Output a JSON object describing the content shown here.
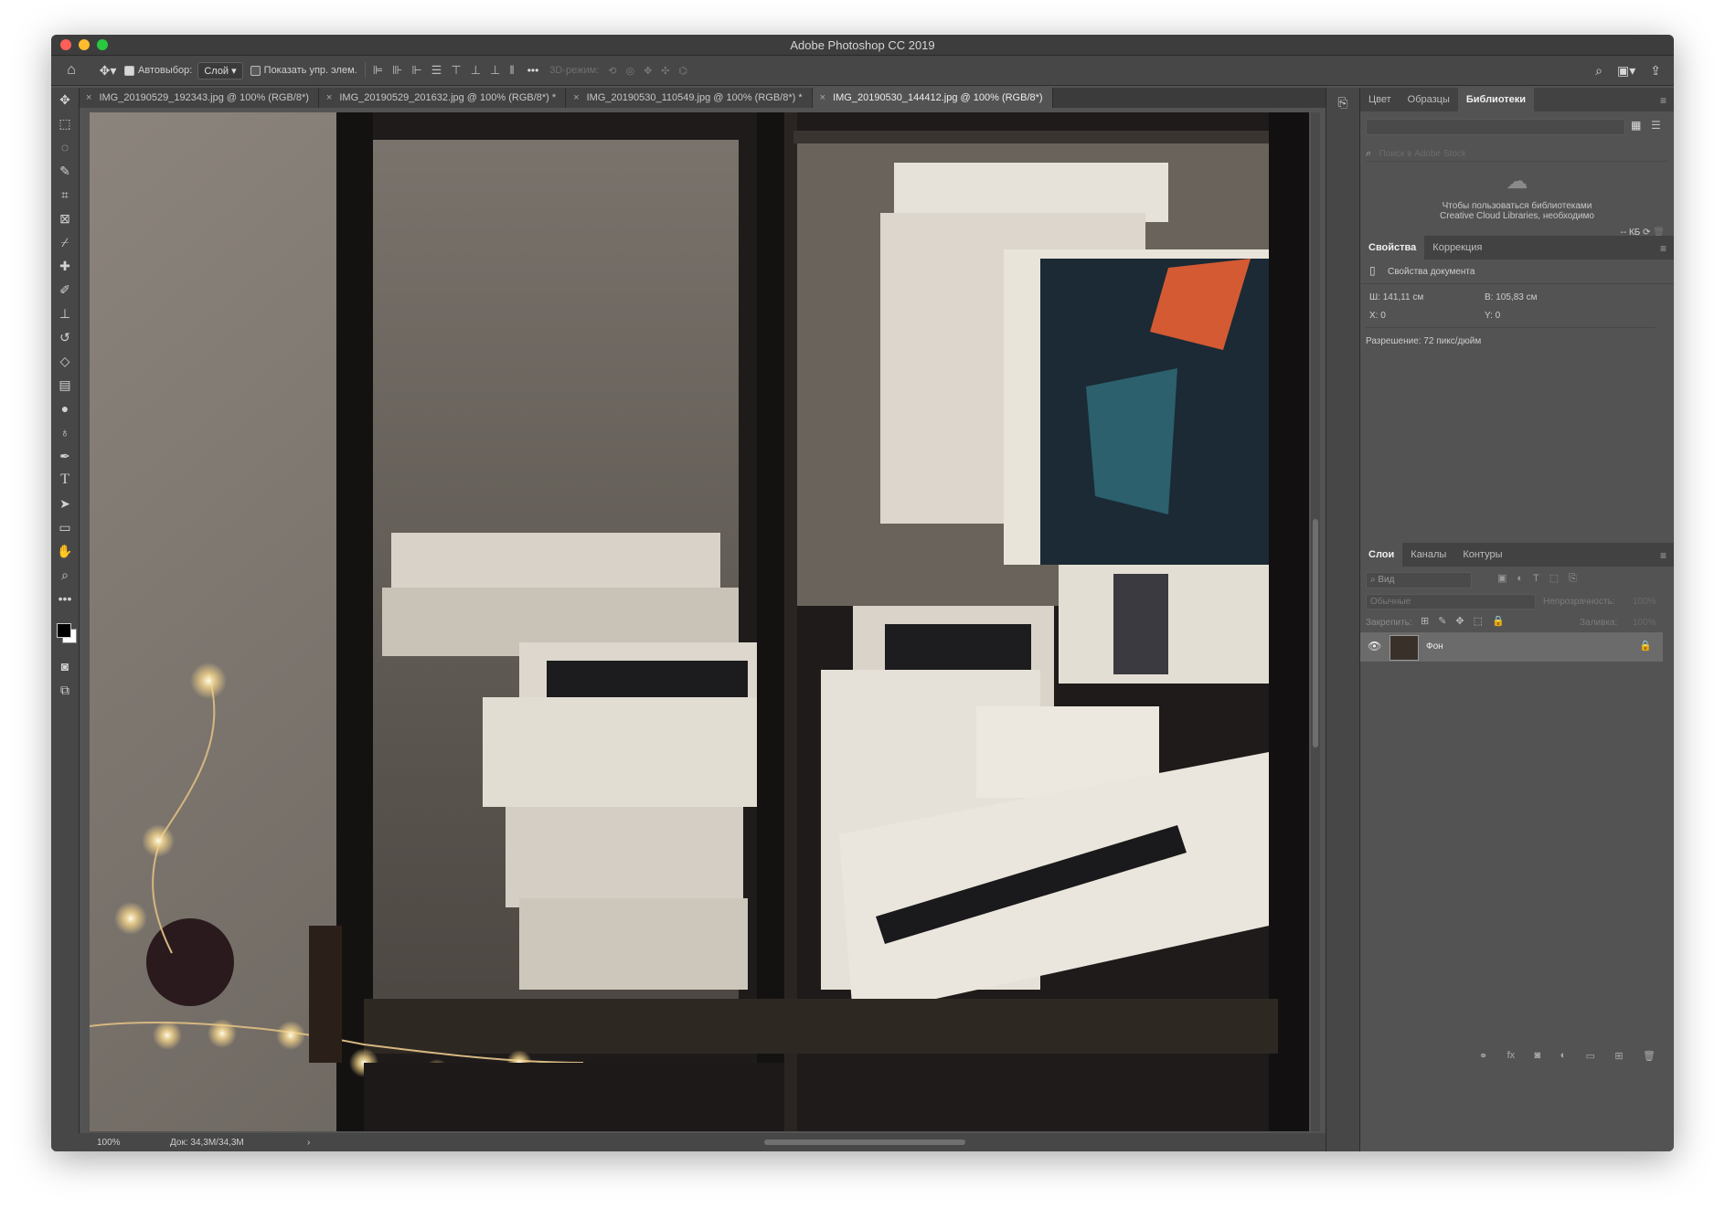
{
  "window": {
    "title": "Adobe Photoshop CC 2019"
  },
  "options_bar": {
    "autoselect_label": "Автовыбор:",
    "autoselect_value": "Слой",
    "show_transform_label": "Показать упр. элем.",
    "mode3d_label": "3D-режим:",
    "more": "•••"
  },
  "tabs": [
    {
      "label": "IMG_20190529_192343.jpg @ 100% (RGB/8*)"
    },
    {
      "label": "IMG_20190529_201632.jpg @ 100% (RGB/8*) *"
    },
    {
      "label": "IMG_20190530_110549.jpg @ 100% (RGB/8*) *"
    },
    {
      "label": "IMG_20190530_144412.jpg @ 100% (RGB/8*)"
    }
  ],
  "status": {
    "zoom": "100%",
    "doc": "Док: 34,3M/34,3M"
  },
  "libraries": {
    "tabs": [
      "Цвет",
      "Образцы",
      "Библиотеки"
    ],
    "search_placeholder": "Поиск в Adobe Stock",
    "message_line1": "Чтобы пользоваться библиотеками",
    "message_line2": "Creative Cloud Libraries, необходимо",
    "size": "-- КБ"
  },
  "properties": {
    "tabs": [
      "Свойства",
      "Коррекция"
    ],
    "doc_title": "Свойства документа",
    "width": "Ш:  141,11 см",
    "height": "В:  105,83 см",
    "x": "X: 0",
    "y": "Y: 0",
    "resolution": "Разрешение: 72 пикс/дюйм"
  },
  "layers": {
    "tabs": [
      "Слои",
      "Каналы",
      "Контуры"
    ],
    "filter": "Вид",
    "blend": "Обычные",
    "opacity_label": "Непрозрачность:",
    "opacity_value": "100%",
    "lock_label": "Закрепить:",
    "fill_label": "Заливка:",
    "fill_value": "100%",
    "items": [
      {
        "name": "Фон"
      }
    ]
  }
}
